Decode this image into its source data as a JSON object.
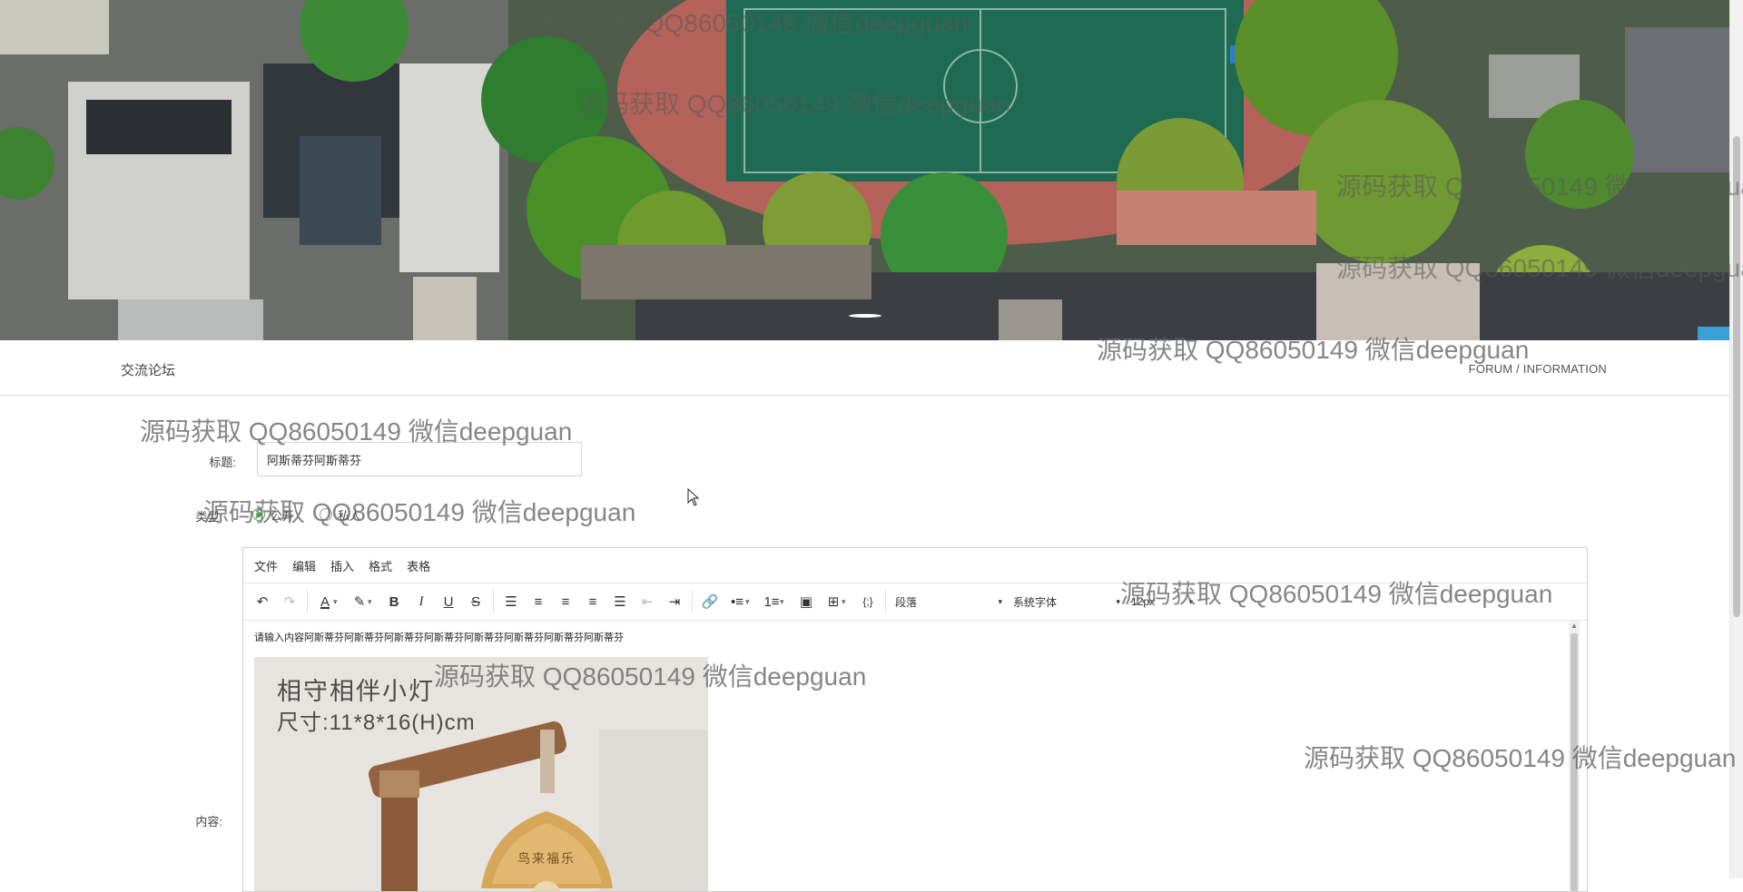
{
  "header": {
    "title": "交流论坛",
    "breadcrumb": "FORUM / INFORMATION"
  },
  "form": {
    "title_label": "标题:",
    "title_value": "阿斯蒂芬阿斯蒂芬",
    "type_label": "类型:",
    "type_options": [
      "公开",
      "私人"
    ],
    "type_selected": "公开",
    "content_label": "内容:"
  },
  "editor": {
    "menus": [
      "文件",
      "编辑",
      "插入",
      "格式",
      "表格"
    ],
    "toolbar_icons": [
      "undo-icon",
      "redo-icon",
      "text-color-icon",
      "highlight-icon",
      "bold-icon",
      "italic-icon",
      "underline-icon",
      "strikethrough-icon",
      "line-height-icon",
      "align-left-icon",
      "align-center-icon",
      "align-right-icon",
      "justify-icon",
      "outdent-icon",
      "indent-icon",
      "link-icon",
      "bullet-list-icon",
      "numbered-list-icon",
      "image-icon",
      "table-icon",
      "code-icon"
    ],
    "block_format": "段落",
    "font_family": "系统字体",
    "font_size": "12px",
    "body_text": "请输入内容阿斯蒂芬阿斯蒂芬阿斯蒂芬阿斯蒂芬阿斯蒂芬阿斯蒂芬阿斯蒂芬阿斯蒂芬",
    "image_caption_line1": "相守相伴小灯",
    "image_caption_line2": "尺寸:11*8*16(H)cm",
    "image_shade_text": "鸟来福乐"
  },
  "watermark": "源码获取 QQ86050149 微信deepguan",
  "colors": {
    "accent_radio": "#4caf50",
    "border": "#cfcfcf"
  }
}
